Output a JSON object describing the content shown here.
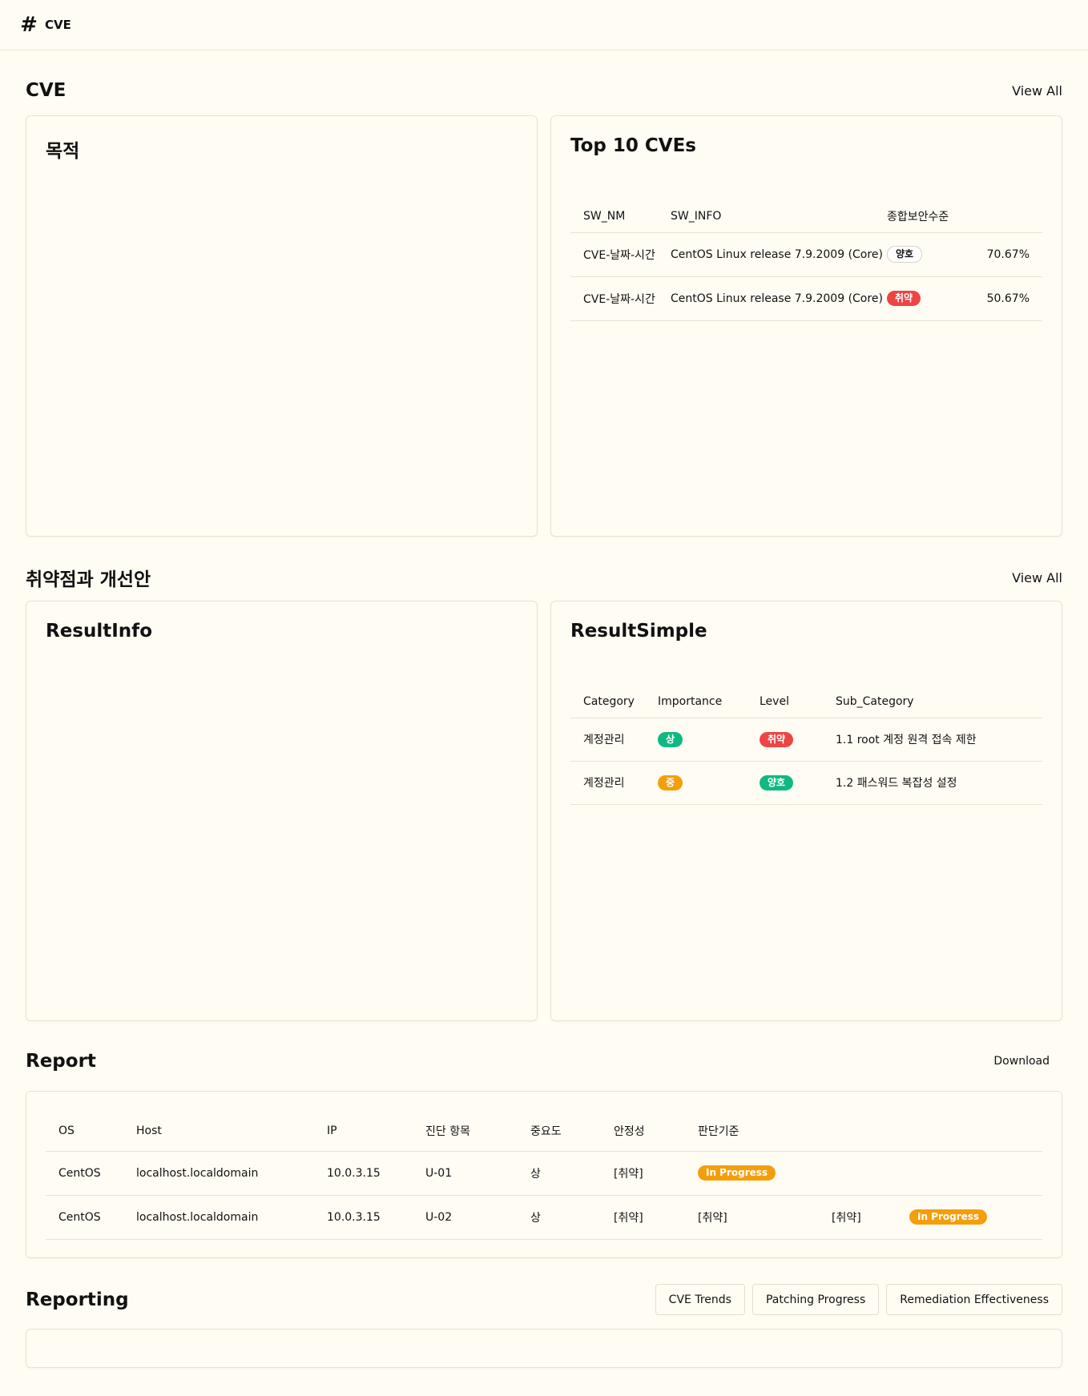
{
  "app": {
    "title": "CVE",
    "logo_icon": "hash-icon"
  },
  "cve_section": {
    "title": "CVE",
    "view_all": "View All",
    "purpose_card": {
      "title": "목적"
    },
    "top_cves": {
      "title": "Top 10 CVEs",
      "columns": [
        "SW_NM",
        "SW_INFO",
        "종합보안수준"
      ],
      "rows": [
        {
          "sw_nm": "CVE-날짜-시간",
          "sw_info": "CentOS Linux release 7.9.2009 (Core)",
          "status": "양호",
          "status_style": "outline",
          "percent": "70.67%"
        },
        {
          "sw_nm": "CVE-날짜-시간",
          "sw_info": "CentOS Linux release 7.9.2009 (Core)",
          "status": "취약",
          "status_style": "red",
          "percent": "50.67%"
        }
      ]
    }
  },
  "vuln_section": {
    "title": "취약점과 개선안",
    "view_all": "View All",
    "result_info": {
      "title": "ResultInfo"
    },
    "result_simple": {
      "title": "ResultSimple",
      "columns": [
        "Category",
        "Importance",
        "Level",
        "Sub_Category"
      ],
      "rows": [
        {
          "category": "계정관리",
          "importance": "상",
          "importance_style": "green",
          "level": "취약",
          "level_style": "red",
          "sub_category": "1.1 root 계정 원격 접속 제한"
        },
        {
          "category": "계정관리",
          "importance": "중",
          "importance_style": "orange",
          "level": "양호",
          "level_style": "green",
          "sub_category": "1.2 패스워드 복잡성 설정"
        }
      ]
    }
  },
  "report_section": {
    "title": "Report",
    "download": "Download",
    "columns": [
      "OS",
      "Host",
      "IP",
      "진단 항목",
      "중요도",
      "안정성",
      "판단기준"
    ],
    "rows": [
      {
        "os": "CentOS",
        "host": "localhost.localdomain",
        "ip": "10.0.3.15",
        "item": "U-01",
        "importance": "상",
        "stability": "[취약]",
        "criteria": "",
        "extra1": "",
        "status": "In Progress"
      },
      {
        "os": "CentOS",
        "host": "localhost.localdomain",
        "ip": "10.0.3.15",
        "item": "U-02",
        "importance": "상",
        "stability": "[취약]",
        "criteria": "[취약]",
        "extra1": "[취약]",
        "status": "In Progress"
      }
    ]
  },
  "reporting_section": {
    "title": "Reporting",
    "tabs": [
      "CVE Trends",
      "Patching Progress",
      "Remediation Effectiveness"
    ]
  },
  "colors": {
    "background": "#fffcf3",
    "red": "#ef4444",
    "green": "#10b981",
    "orange": "#f59e0b"
  }
}
